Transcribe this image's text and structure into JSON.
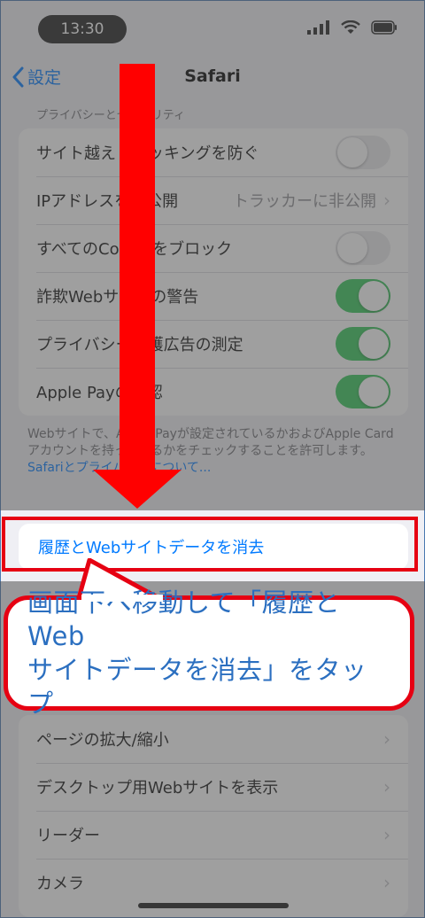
{
  "status_bar": {
    "time": "13:30"
  },
  "nav": {
    "back_label": "設定",
    "title": "Safari"
  },
  "privacy_section": {
    "header": "プライバシーとセキュリティ",
    "rows": [
      {
        "label": "サイト越えトラッキングを防ぐ",
        "control": "toggle",
        "on": false
      },
      {
        "label": "IPアドレスを非公開",
        "control": "value",
        "value": "トラッカーに非公開"
      },
      {
        "label": "すべてのCookieをブロック",
        "control": "toggle",
        "on": false
      },
      {
        "label": "詐欺Webサイトの警告",
        "control": "toggle",
        "on": true
      },
      {
        "label": "プライバシー保護広告の測定",
        "control": "toggle",
        "on": true
      },
      {
        "label": "Apple Payの確認",
        "control": "toggle",
        "on": true
      }
    ],
    "footer": "Webサイトで、Apple Payが設定されているかおよびApple Cardアカウントを持っているかをチェックすることを許可します。",
    "footer_link": "Safariとプライバシーについて..."
  },
  "clear_history": {
    "label": "履歴とWebサイトデータを消去"
  },
  "bottom_section": {
    "rows": [
      {
        "label": "ページの拡大/縮小"
      },
      {
        "label": "デスクトップ用Webサイトを表示"
      },
      {
        "label": "リーダー"
      },
      {
        "label": "カメラ"
      }
    ]
  },
  "annotation": {
    "callout_line1": "画面下へ移動して「履歴とWeb",
    "callout_line2": "サイトデータを消去」をタップ"
  },
  "colors": {
    "accent": "#007aff",
    "toggle_on": "#34c759",
    "annotation_red": "#e60012",
    "callout_text": "#2b6fc0"
  }
}
